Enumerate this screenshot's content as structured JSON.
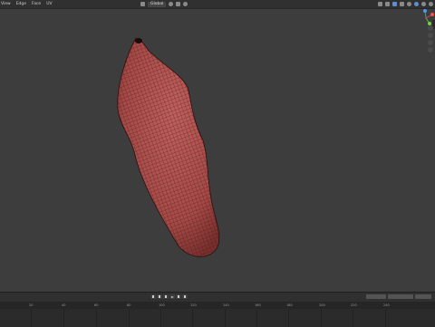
{
  "header": {
    "menu": [
      "View",
      "Edge",
      "Face",
      "UV"
    ],
    "view_dropdown": "Global"
  },
  "timeline": {
    "ruler_ticks": [
      "20",
      "40",
      "60",
      "80",
      "100",
      "120",
      "140",
      "160",
      "180",
      "200",
      "220",
      "240"
    ]
  }
}
